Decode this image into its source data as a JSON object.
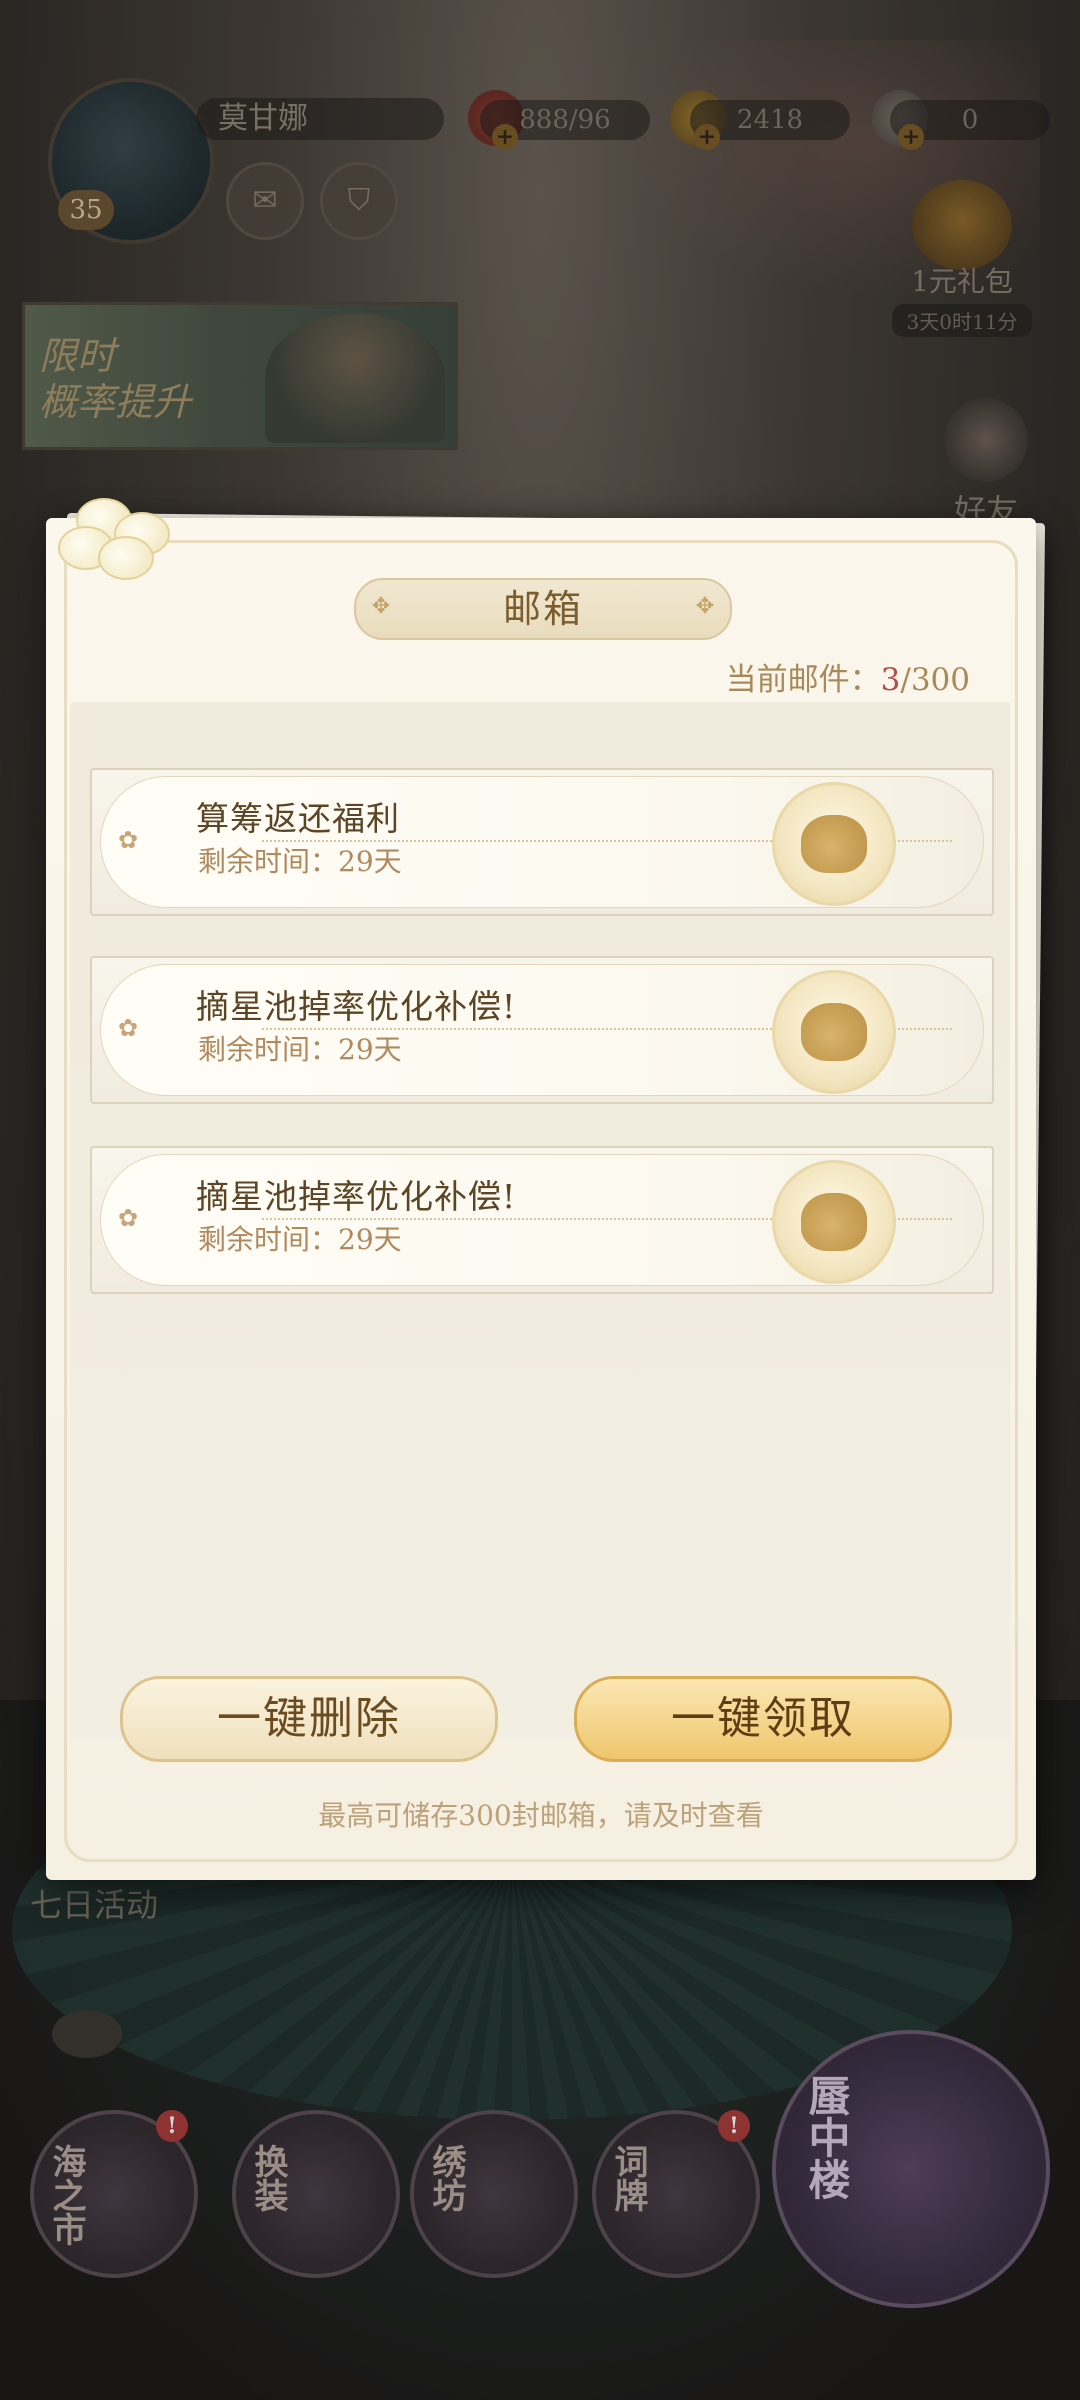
{
  "top_bar": {
    "player_name": "莫甘娜",
    "level": "35",
    "stamina": "888/96",
    "gold": "2418",
    "gems": "0",
    "gift_label": "1元礼包",
    "gift_timer": "3天0时11分"
  },
  "banner": {
    "text": "限时\n概率提升"
  },
  "friend_label": "好友",
  "seven_day_label": "七日活动",
  "nav": [
    {
      "label": "海之市",
      "badge": "!"
    },
    {
      "label": "换装",
      "badge": ""
    },
    {
      "label": "绣坊",
      "badge": ""
    },
    {
      "label": "词牌",
      "badge": "!"
    }
  ],
  "tower_label": "蜃中楼",
  "mailbox": {
    "title": "邮箱",
    "count_label": "当前邮件：",
    "count_current": "3",
    "count_max": "/300",
    "mails": [
      {
        "title": "算筹返还福利",
        "remaining": "剩余时间：29天"
      },
      {
        "title": "摘星池掉率优化补偿!",
        "remaining": "剩余时间：29天"
      },
      {
        "title": "摘星池掉率优化补偿!",
        "remaining": "剩余时间：29天"
      }
    ],
    "delete_all_label": "一键删除",
    "claim_all_label": "一键领取",
    "footer_note": "最高可储存300封邮箱，请及时查看"
  },
  "colors": {
    "dialog_bg": "#f8f4e8",
    "title_text": "#7b5d2e",
    "count_highlight": "#b0504a",
    "claim_button": "#f0c66d"
  }
}
